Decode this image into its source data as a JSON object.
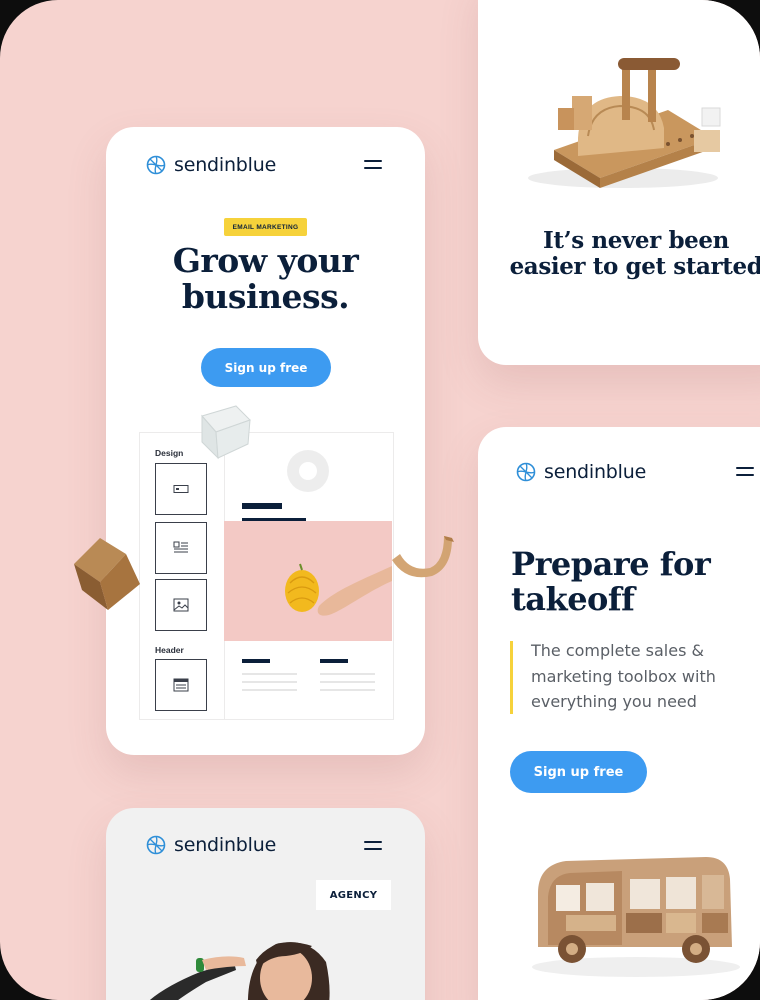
{
  "brand": {
    "name": "sendinblue",
    "accent": "#3d9bf1",
    "badge_color": "#f6d23b",
    "navy": "#0b1f3a",
    "pink": "#f6d3cf"
  },
  "card_main": {
    "badge": "EMAIL MARKETING",
    "headline_line1": "Grow your",
    "headline_line2": "business.",
    "cta": "Sign up free",
    "builder": {
      "design_label": "Design",
      "header_label": "Header"
    }
  },
  "card_top_right": {
    "headline_line1": "It’s never been",
    "headline_line2": "easier to get started"
  },
  "card_right": {
    "headline_line1": "Prepare for",
    "headline_line2": "takeoff",
    "body_line1": "The complete sales &",
    "body_line2": "marketing toolbox with",
    "body_line3": "everything you need",
    "cta": "Sign up free"
  },
  "card_bottom": {
    "tag": "AGENCY"
  },
  "icons": [
    "sendinblue-logo-icon",
    "menu-icon",
    "button-block-icon",
    "text-block-icon",
    "image-block-icon",
    "header-block-icon"
  ]
}
